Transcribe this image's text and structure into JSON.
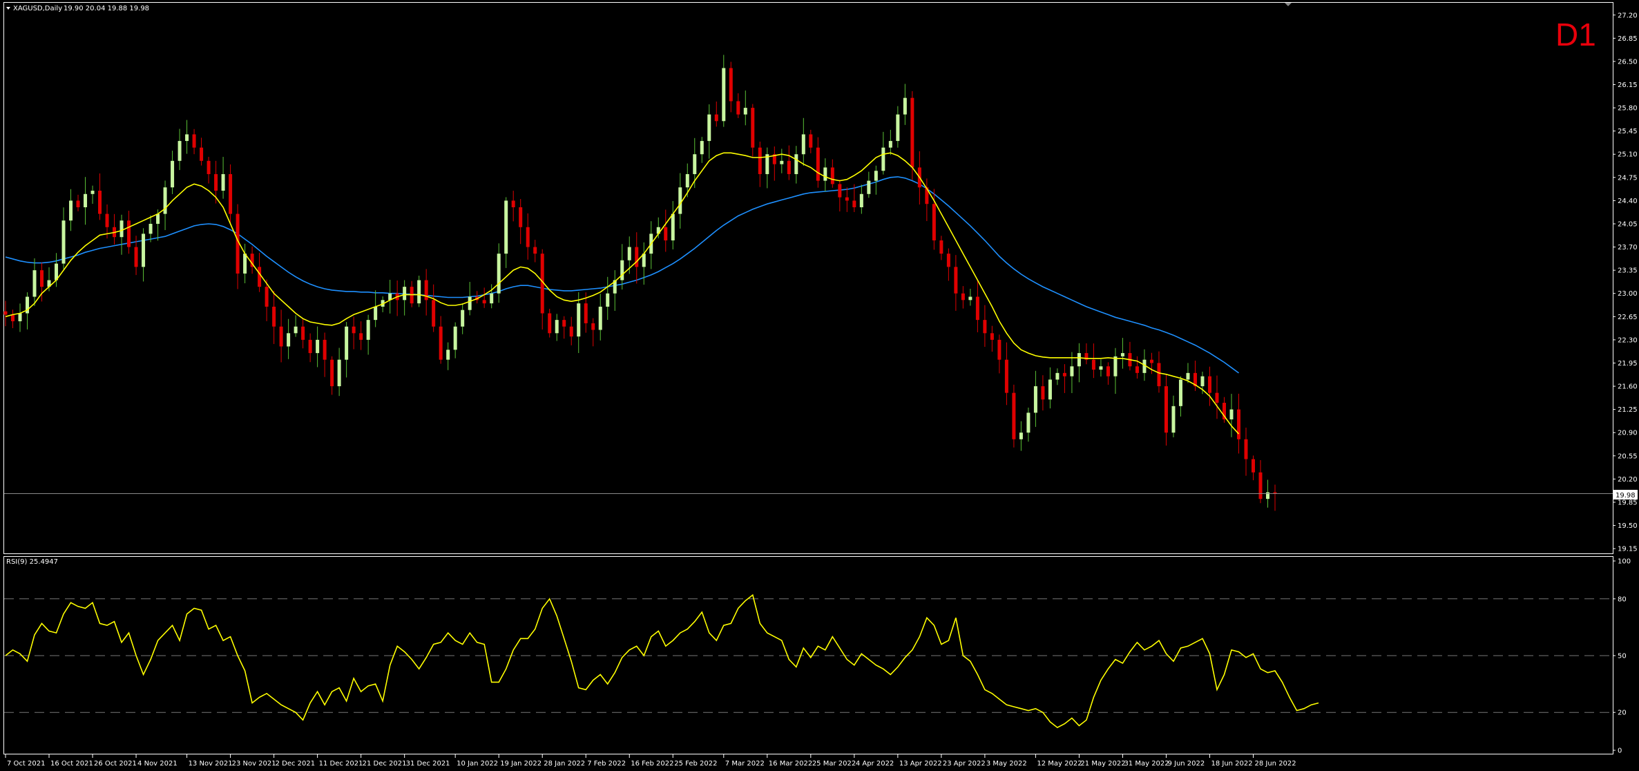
{
  "header": {
    "symbol": "XAGUSD,Daily",
    "ohlc": "19.90 20.04 19.88 19.98"
  },
  "timeframe_badge": "D1",
  "rsi_header": "RSI(9) 25.4947",
  "price_marker": "19.98",
  "colors": {
    "background": "#000000",
    "bull_candle": "#c8f5a0",
    "bear_candle": "#e00000",
    "ma_fast": "#ffff00",
    "ma_slow": "#1e90ff",
    "rsi_line": "#ffff00",
    "timeframe_badge": "#e8000b",
    "axis": "#ffffff",
    "level_lines": "#777777"
  },
  "chart_data": [
    {
      "type": "candlestick",
      "title": "XAGUSD,Daily",
      "y_ticks": [
        "27.20",
        "26.85",
        "26.50",
        "26.15",
        "25.80",
        "25.45",
        "25.10",
        "24.75",
        "24.40",
        "24.05",
        "23.70",
        "23.35",
        "23.00",
        "22.65",
        "22.30",
        "21.95",
        "21.60",
        "21.25",
        "20.90",
        "20.55",
        "20.20",
        "19.85",
        "19.50",
        "19.15"
      ],
      "ylim": [
        19.12,
        27.26
      ],
      "x_ticks": [
        "7 Oct 2021",
        "16 Oct 2021",
        "26 Oct 2021",
        "4 Nov 2021",
        "13 Nov 2021",
        "23 Nov 2021",
        "2 Dec 2021",
        "11 Dec 2021",
        "21 Dec 2021",
        "31 Dec 2021",
        "10 Jan 2022",
        "19 Jan 2022",
        "28 Jan 2022",
        "7 Feb 2022",
        "16 Feb 2022",
        "25 Feb 2022",
        "7 Mar 2022",
        "16 Mar 2022",
        "25 Mar 2022",
        "4 Apr 2022",
        "13 Apr 2022",
        "23 Apr 2022",
        "3 May 2022",
        "12 May 2022",
        "21 May 2022",
        "31 May 2022",
        "9 Jun 2022",
        "18 Jun 2022",
        "28 Jun 2022"
      ],
      "close": [
        22.68,
        22.58,
        22.7,
        22.95,
        23.35,
        23.1,
        23.2,
        23.45,
        24.1,
        24.4,
        24.3,
        24.5,
        24.55,
        24.2,
        24.0,
        23.85,
        24.1,
        23.7,
        23.4,
        23.9,
        24.05,
        24.2,
        24.6,
        25.0,
        25.3,
        25.4,
        25.2,
        25.0,
        24.8,
        24.55,
        24.8,
        24.2,
        23.3,
        23.6,
        23.4,
        23.1,
        22.8,
        22.5,
        22.2,
        22.4,
        22.5,
        22.3,
        22.1,
        22.3,
        22.0,
        21.6,
        22.0,
        22.5,
        22.4,
        22.3,
        22.6,
        22.8,
        22.9,
        23.0,
        22.9,
        23.1,
        22.85,
        23.2,
        22.9,
        22.5,
        22.0,
        22.15,
        22.5,
        22.75,
        22.95,
        22.9,
        22.85,
        23.0,
        23.6,
        24.4,
        24.3,
        24.0,
        23.7,
        23.6,
        22.7,
        22.4,
        22.6,
        22.5,
        22.35,
        22.85,
        22.55,
        22.45,
        22.8,
        23.0,
        23.2,
        23.5,
        23.7,
        23.4,
        23.6,
        23.9,
        24.0,
        23.8,
        24.2,
        24.6,
        24.8,
        25.1,
        25.3,
        25.7,
        25.6,
        26.4,
        25.9,
        25.7,
        25.8,
        25.2,
        24.8,
        25.1,
        24.95,
        25.0,
        24.8,
        25.1,
        25.4,
        25.2,
        24.7,
        24.9,
        24.65,
        24.45,
        24.4,
        24.3,
        24.5,
        24.7,
        24.85,
        25.2,
        25.3,
        25.7,
        25.95,
        24.9,
        24.6,
        24.35,
        23.8,
        23.6,
        23.4,
        23.0,
        22.9,
        22.95,
        22.6,
        22.4,
        22.3,
        22.0,
        21.5,
        20.8,
        20.9,
        21.2,
        21.6,
        21.4,
        21.7,
        21.8,
        21.75,
        21.9,
        22.1,
        22.0,
        21.85,
        21.9,
        21.75,
        22.05,
        22.1,
        21.9,
        21.8,
        22.0,
        21.95,
        21.6,
        20.9,
        21.3,
        21.7,
        21.8,
        21.6,
        21.75,
        21.5,
        21.35,
        21.1,
        21.25,
        20.8,
        20.5,
        20.3,
        19.9,
        20.0,
        19.98
      ],
      "series": [
        {
          "name": "",
          "color": "#ffff00",
          "values": [
            22.65,
            22.68,
            22.7,
            22.75,
            22.85,
            23.0,
            23.1,
            23.2,
            23.35,
            23.5,
            23.62,
            23.72,
            23.8,
            23.88,
            23.9,
            23.92,
            23.95,
            24.0,
            24.05,
            24.1,
            24.15,
            24.2,
            24.28,
            24.4,
            24.5,
            24.6,
            24.65,
            24.62,
            24.55,
            24.45,
            24.3,
            24.05,
            23.8,
            23.6,
            23.45,
            23.3,
            23.15,
            23.0,
            22.9,
            22.8,
            22.7,
            22.62,
            22.57,
            22.55,
            22.53,
            22.52,
            22.55,
            22.62,
            22.68,
            22.72,
            22.76,
            22.8,
            22.84,
            22.9,
            22.95,
            22.98,
            22.98,
            22.98,
            22.96,
            22.92,
            22.86,
            22.82,
            22.82,
            22.84,
            22.88,
            22.92,
            22.98,
            23.05,
            23.15,
            23.25,
            23.35,
            23.4,
            23.38,
            23.3,
            23.18,
            23.05,
            22.95,
            22.9,
            22.88,
            22.9,
            22.93,
            22.97,
            23.02,
            23.1,
            23.18,
            23.28,
            23.38,
            23.48,
            23.6,
            23.75,
            23.9,
            24.05,
            24.2,
            24.35,
            24.52,
            24.7,
            24.85,
            25.0,
            25.08,
            25.12,
            25.12,
            25.1,
            25.08,
            25.05,
            25.05,
            25.06,
            25.08,
            25.1,
            25.08,
            25.02,
            24.95,
            24.9,
            24.82,
            24.76,
            24.72,
            24.7,
            24.72,
            24.78,
            24.85,
            24.95,
            25.05,
            25.1,
            25.12,
            25.08,
            25.0,
            24.9,
            24.75,
            24.58,
            24.4,
            24.2,
            24.0,
            23.8,
            23.6,
            23.4,
            23.2,
            23.0,
            22.8,
            22.58,
            22.4,
            22.25,
            22.15,
            22.1,
            22.06,
            22.04,
            22.03,
            22.03,
            22.03,
            22.03,
            22.03,
            22.02,
            22.02,
            22.02,
            22.03,
            22.02,
            22.02,
            22.0,
            21.98,
            21.92,
            21.85,
            21.8,
            21.78,
            21.75,
            21.72,
            21.68,
            21.62,
            21.55,
            21.45,
            21.3,
            21.15,
            21.0,
            20.88
          ]
        },
        {
          "name": "",
          "color": "#1e90ff",
          "values": [
            23.55,
            23.52,
            23.49,
            23.47,
            23.46,
            23.46,
            23.47,
            23.49,
            23.52,
            23.55,
            23.58,
            23.62,
            23.65,
            23.68,
            23.7,
            23.72,
            23.74,
            23.76,
            23.78,
            23.8,
            23.82,
            23.84,
            23.86,
            23.9,
            23.94,
            23.98,
            24.02,
            24.04,
            24.05,
            24.04,
            24.01,
            23.96,
            23.9,
            23.82,
            23.74,
            23.65,
            23.56,
            23.48,
            23.4,
            23.32,
            23.25,
            23.19,
            23.14,
            23.1,
            23.07,
            23.05,
            23.04,
            23.03,
            23.03,
            23.02,
            23.02,
            23.01,
            23.01,
            23.0,
            23.0,
            22.99,
            22.99,
            22.98,
            22.97,
            22.96,
            22.95,
            22.94,
            22.94,
            22.94,
            22.95,
            22.96,
            22.98,
            23.0,
            23.03,
            23.07,
            23.1,
            23.12,
            23.12,
            23.1,
            23.08,
            23.06,
            23.05,
            23.04,
            23.04,
            23.05,
            23.06,
            23.07,
            23.08,
            23.1,
            23.12,
            23.14,
            23.17,
            23.2,
            23.24,
            23.28,
            23.33,
            23.39,
            23.45,
            23.52,
            23.6,
            23.68,
            23.77,
            23.86,
            23.95,
            24.03,
            24.1,
            24.17,
            24.22,
            24.27,
            24.31,
            24.35,
            24.38,
            24.41,
            24.44,
            24.47,
            24.5,
            24.52,
            24.53,
            24.54,
            24.55,
            24.56,
            24.57,
            24.59,
            24.62,
            24.65,
            24.68,
            24.72,
            24.75,
            24.76,
            24.74,
            24.7,
            24.65,
            24.58,
            24.5,
            24.41,
            24.32,
            24.22,
            24.12,
            24.02,
            23.91,
            23.8,
            23.68,
            23.56,
            23.46,
            23.37,
            23.29,
            23.22,
            23.16,
            23.1,
            23.05,
            23.0,
            22.95,
            22.9,
            22.85,
            22.8,
            22.76,
            22.72,
            22.68,
            22.64,
            22.61,
            22.58,
            22.55,
            22.52,
            22.48,
            22.45,
            22.41,
            22.37,
            22.32,
            22.27,
            22.22,
            22.16,
            22.1,
            22.03,
            21.96,
            21.88,
            21.8
          ]
        }
      ]
    },
    {
      "type": "line",
      "title": "RSI(9) 25.4947",
      "y_ticks": [
        "100",
        "80",
        "50",
        "20",
        "0"
      ],
      "levels": [
        80,
        50,
        20
      ],
      "ylim": [
        0,
        100
      ],
      "series": [
        {
          "name": "",
          "color": "#ffff00",
          "values": [
            50,
            53,
            51,
            47,
            61,
            67,
            63,
            62,
            72,
            78,
            76,
            75,
            78,
            67,
            66,
            68,
            57,
            62,
            50,
            40,
            48,
            58,
            62,
            66,
            58,
            72,
            75,
            74,
            64,
            66,
            58,
            60,
            50,
            42,
            25,
            28,
            30,
            27,
            24,
            22,
            20,
            16,
            25,
            31,
            24,
            31,
            33,
            26,
            38,
            31,
            34,
            35,
            26,
            45,
            55,
            52,
            48,
            43,
            49,
            56,
            57,
            62,
            58,
            56,
            62,
            57,
            56,
            36,
            36,
            43,
            53,
            59,
            59,
            64,
            75,
            80,
            71,
            59,
            47,
            33,
            32,
            37,
            40,
            35,
            41,
            49,
            53,
            55,
            50,
            60,
            63,
            55,
            58,
            62,
            64,
            68,
            73,
            62,
            58,
            66,
            67,
            75,
            79,
            82,
            67,
            62,
            60,
            58,
            48,
            44,
            54,
            49,
            55,
            53,
            60,
            54,
            48,
            45,
            51,
            48,
            45,
            43,
            40,
            44,
            49,
            53,
            60,
            70,
            66,
            56,
            58,
            70,
            50,
            47,
            40,
            32,
            30,
            27,
            24,
            23,
            22,
            21,
            22,
            20,
            15,
            12,
            14,
            17,
            13,
            16,
            28,
            37,
            43,
            48,
            46,
            52,
            57,
            53,
            55,
            58,
            51,
            47,
            54,
            55,
            57,
            59,
            51,
            32,
            40,
            53,
            52,
            49,
            51,
            43,
            41,
            42,
            36,
            28,
            21,
            22,
            24,
            25
          ]
        }
      ]
    }
  ]
}
